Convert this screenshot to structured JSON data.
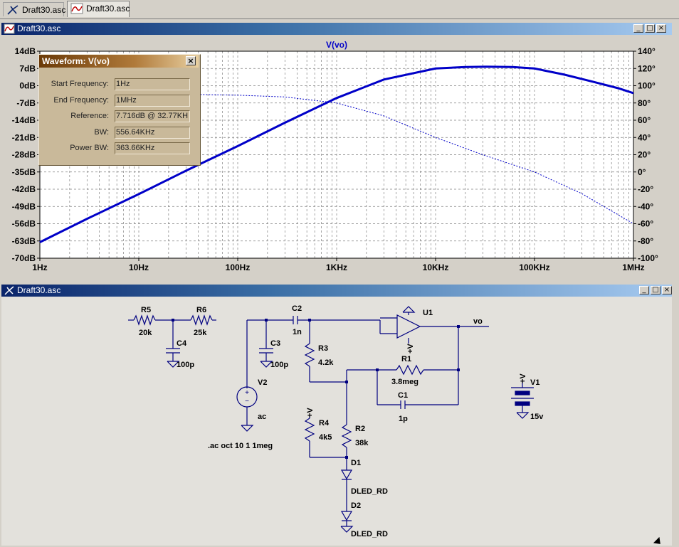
{
  "tabs": [
    {
      "label": "Draft30.asc",
      "icon": "schematic-icon",
      "active": false
    },
    {
      "label": "Draft30.asc",
      "icon": "waveform-icon",
      "active": true
    }
  ],
  "waveform_window": {
    "title": "Draft30.asc",
    "trace_label": "V(vo)",
    "buttons": [
      "_",
      "□",
      "×"
    ]
  },
  "schematic_window": {
    "title": "Draft30.asc",
    "buttons": [
      "_",
      "□",
      "×"
    ]
  },
  "dialog": {
    "title": "Waveform: V(vo)",
    "close": "×",
    "rows": [
      {
        "label": "Start Frequency:",
        "value": "1Hz"
      },
      {
        "label": "End Frequency:",
        "value": "1MHz"
      },
      {
        "label": "Reference:",
        "value": "7.716dB @ 32.77KH"
      },
      {
        "label": "BW:",
        "value": "556.64KHz"
      },
      {
        "label": "Power BW:",
        "value": "363.66KHz"
      }
    ]
  },
  "chart_data": {
    "type": "line",
    "title": "V(vo)",
    "x_scale": "log",
    "xlim": [
      1,
      1000000
    ],
    "x_ticks": [
      "1Hz",
      "10Hz",
      "100Hz",
      "1KHz",
      "10KHz",
      "100KHz",
      "1MHz"
    ],
    "y_left_ticks": [
      "14dB",
      "7dB",
      "0dB",
      "-7dB",
      "-14dB",
      "-21dB",
      "-28dB",
      "-35dB",
      "-42dB",
      "-49dB",
      "-56dB",
      "-63dB",
      "-70dB"
    ],
    "y_right_ticks": [
      "140°",
      "120°",
      "100°",
      "80°",
      "60°",
      "40°",
      "20°",
      "0°",
      "-20°",
      "-40°",
      "-60°",
      "-80°",
      "-100°"
    ],
    "ylim_left": [
      -70,
      14
    ],
    "ylim_right": [
      -100,
      140
    ],
    "grid": true,
    "series": [
      {
        "name": "magnitude",
        "color": "#0000c8",
        "style": "solid",
        "x": [
          1,
          3,
          10,
          30,
          100,
          300,
          1000,
          3000,
          10000,
          20000,
          32770,
          60000,
          100000,
          200000,
          400000,
          700000,
          1000000
        ],
        "y": [
          -63.5,
          -54,
          -44,
          -34.5,
          -24.5,
          -15,
          -5,
          2.5,
          7,
          7.6,
          7.72,
          7.6,
          7,
          4.5,
          1.5,
          -1,
          -3
        ]
      },
      {
        "name": "phase",
        "color": "#0000c8",
        "style": "dashed",
        "x": [
          30,
          100,
          300,
          1000,
          3000,
          10000,
          30000,
          100000,
          300000,
          1000000
        ],
        "y": [
          90,
          89,
          87,
          80,
          65,
          40,
          20,
          0,
          -25,
          -60
        ]
      }
    ]
  },
  "schematic": {
    "labels": {
      "R5": "R5",
      "R5v": "20k",
      "R6": "R6",
      "R6v": "25k",
      "C4": "C4",
      "C4v": "100p",
      "C3": "C3",
      "C3v": "100p",
      "C2": "C2",
      "C2v": "1n",
      "R3": "R3",
      "R3v": "4.2k",
      "V2": "V2",
      "V2v": "ac",
      "directive": ".ac oct 10 1 1meg",
      "R4": "R4",
      "R4v": "4k5",
      "R2": "R2",
      "R2v": "38k",
      "D1": "D1",
      "D1v": "DLED_RD",
      "D2": "D2",
      "D2v": "DLED_RD",
      "U1": "U1",
      "vo": "vo",
      "R1": "R1",
      "R1v": "3.8meg",
      "C1": "C1",
      "C1v": "1p",
      "V1": "V1",
      "V1v": "15v",
      "vplus": "+V"
    },
    "wire_color": "#000080",
    "ground_color": "#000080"
  }
}
